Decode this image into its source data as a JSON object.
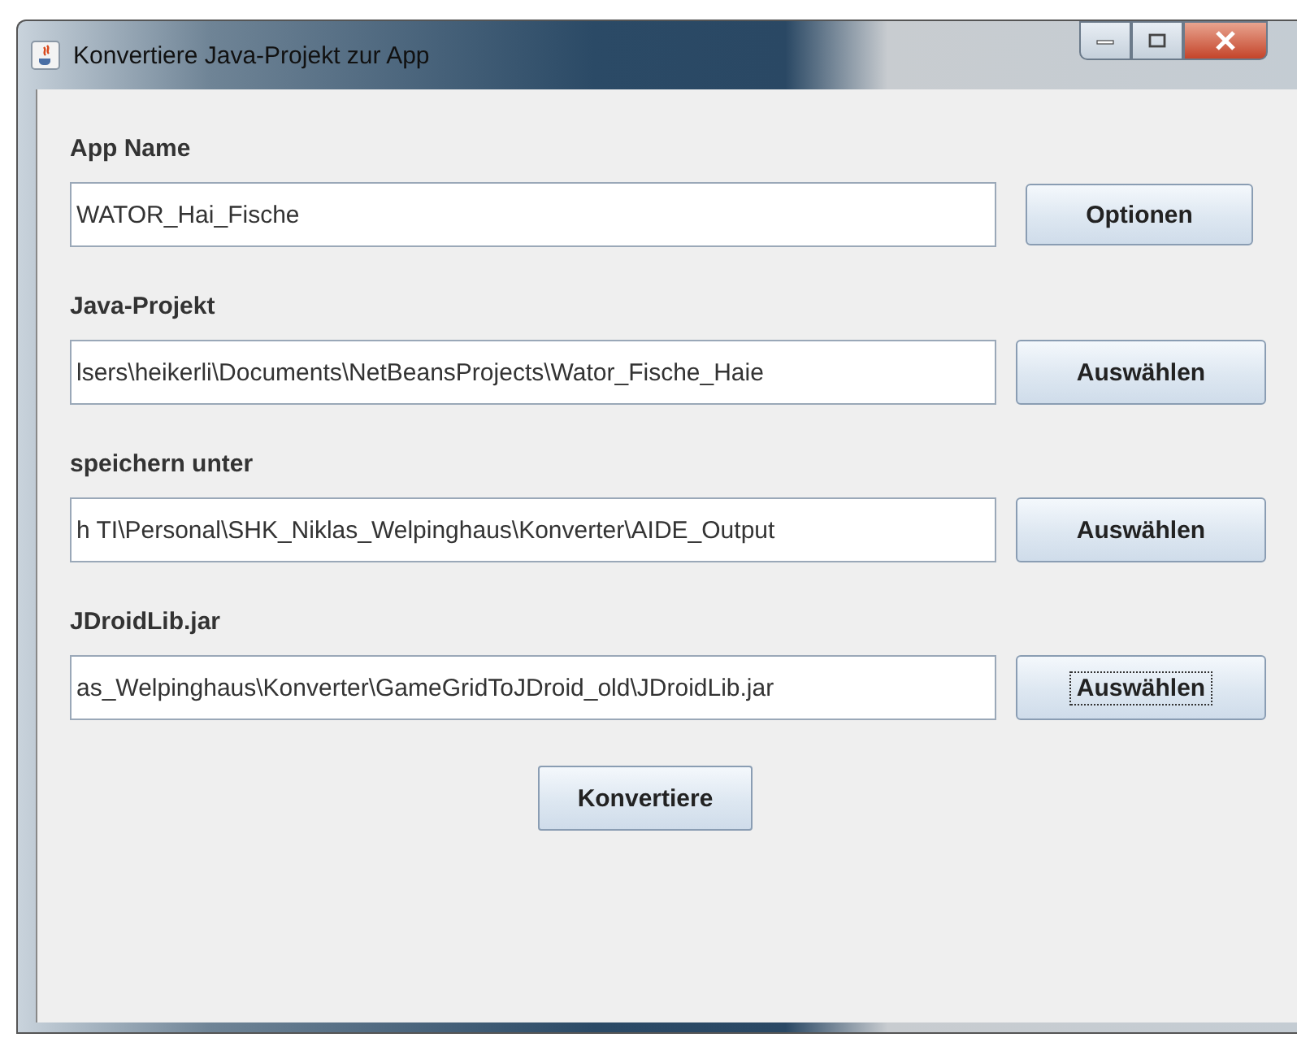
{
  "window": {
    "title": "Konvertiere Java-Projekt zur App"
  },
  "rows": [
    {
      "label": "App Name",
      "value": "WATOR_Hai_Fische",
      "button": {
        "label": "Optionen",
        "focused": false
      }
    },
    {
      "label": "Java-Projekt",
      "value": "lsers\\heikerli\\Documents\\NetBeansProjects\\Wator_Fische_Haie",
      "button": {
        "label": "Auswählen",
        "focused": false
      }
    },
    {
      "label": "speichern unter",
      "value": "h TI\\Personal\\SHK_Niklas_Welpinghaus\\Konverter\\AIDE_Output",
      "button": {
        "label": "Auswählen",
        "focused": false
      }
    },
    {
      "label": "JDroidLib.jar",
      "value": "as_Welpinghaus\\Konverter\\GameGridToJDroid_old\\JDroidLib.jar",
      "button": {
        "label": "Auswählen",
        "focused": true
      }
    }
  ],
  "convert_button": {
    "label": "Konvertiere"
  }
}
